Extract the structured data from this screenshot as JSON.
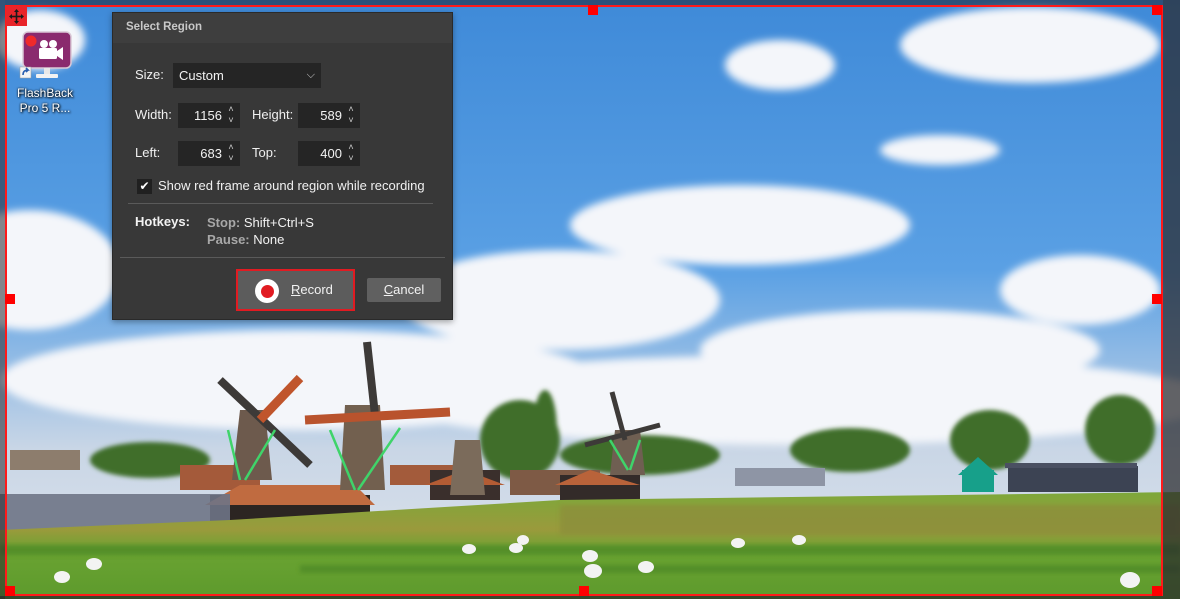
{
  "desktop": {
    "icon": {
      "name": "flashback-pro-icon",
      "label_line1": "FlashBack",
      "label_line2": "Pro 5 R..."
    },
    "wallpaper": "windmills-landscape"
  },
  "selection": {
    "frame_color": "#ff1a1a",
    "move_handle_icon": "move-arrows-icon"
  },
  "dialog": {
    "title": "Select Region",
    "size": {
      "label": "Size:",
      "value": "Custom"
    },
    "width": {
      "label": "Width:",
      "value": "1156"
    },
    "height": {
      "label": "Height:",
      "value": "589"
    },
    "left": {
      "label": "Left:",
      "value": "683"
    },
    "top": {
      "label": "Top:",
      "value": "400"
    },
    "show_frame": {
      "label": "Show red frame around region while recording",
      "checked": true
    },
    "hotkeys": {
      "label": "Hotkeys:",
      "stop_key": "Stop:",
      "stop_value": "Shift+Ctrl+S",
      "pause_key": "Pause:",
      "pause_value": "None"
    },
    "buttons": {
      "record_accel": "R",
      "record_rest": "ecord",
      "cancel_accel": "C",
      "cancel_rest": "ancel"
    },
    "colors": {
      "record_accent": "#e11b22",
      "background": "#383838"
    }
  }
}
